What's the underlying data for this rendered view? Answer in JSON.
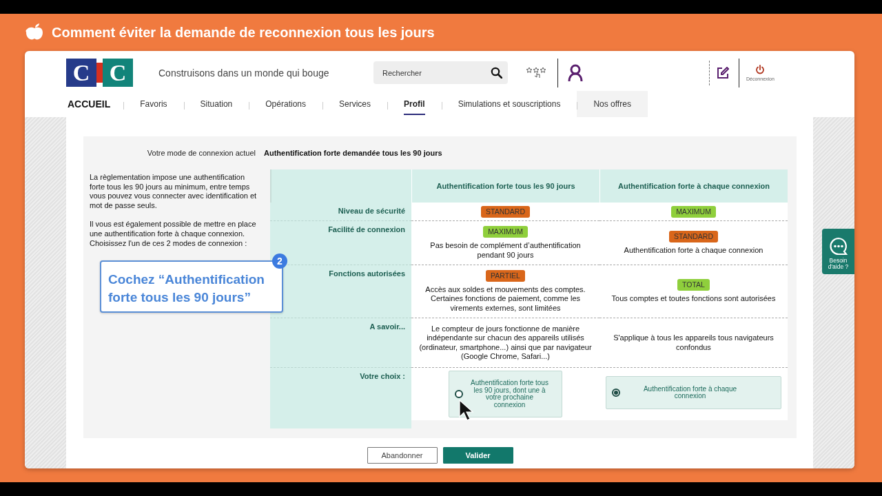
{
  "video_title": "Comment éviter la demande de reconnexion tous les jours",
  "header": {
    "logo_letters": [
      "C",
      "C"
    ],
    "tagline": "Construisons dans un monde qui bouge",
    "search": {
      "placeholder": "Rechercher"
    },
    "logout": "Déconnexion"
  },
  "nav": [
    {
      "label": "ACCUEIL",
      "kind": "home",
      "selected": false
    },
    {
      "label": "Favoris",
      "kind": "link",
      "selected": false
    },
    {
      "label": "Situation",
      "kind": "link",
      "selected": false
    },
    {
      "label": "Opérations",
      "kind": "link",
      "selected": false
    },
    {
      "label": "Services",
      "kind": "link",
      "selected": false
    },
    {
      "label": "Profil",
      "kind": "link",
      "selected": true
    },
    {
      "label": "Simulations et souscriptions",
      "kind": "link",
      "selected": false
    },
    {
      "label": "Nos offres",
      "kind": "offer",
      "selected": false
    }
  ],
  "current_mode": {
    "label": "Votre mode de connexion actuel",
    "value": "Authentification forte demandée tous les 90 jours"
  },
  "intro": [
    "La règlementation impose une authentification forte tous les 90 jours au minimum, entre temps vous pouvez vous connecter avec identification et mot de passe seuls.",
    "Il vous est également possible de mettre en place une authentification forte à chaque connexion. Choisissez l'un de ces 2 modes de connexion :"
  ],
  "callout": {
    "number": "2",
    "text": "Cochez “Authentification forte tous les 90 jours”"
  },
  "comparison": {
    "columns": [
      "Authentification forte tous les 90 jours",
      "Authentification forte à chaque connexion"
    ],
    "rows": [
      {
        "label": "Niveau de sécurité",
        "cells": [
          {
            "badge": {
              "text": "STANDARD",
              "color": "#d9661a"
            }
          },
          {
            "badge": {
              "text": "MAXIMUM",
              "color": "#8fcf3c"
            }
          }
        ]
      },
      {
        "label": "Facilité de connexion",
        "cells": [
          {
            "badge": {
              "text": "MAXIMUM",
              "color": "#8fcf3c"
            },
            "text": "Pas besoin de complément d’authentification pendant 90 jours"
          },
          {
            "badge": {
              "text": "STANDARD",
              "color": "#d9661a"
            },
            "text": "Authentification forte à chaque connexion"
          }
        ]
      },
      {
        "label": "Fonctions autorisées",
        "cells": [
          {
            "badge": {
              "text": "PARTIEL",
              "color": "#d9661a"
            },
            "text": "Accès aux soldes et mouvements des comptes. Certaines fonctions de paiement, comme les virements externes, sont limitées"
          },
          {
            "badge": {
              "text": "TOTAL",
              "color": "#8fcf3c"
            },
            "text": "Tous comptes et toutes fonctions sont autorisées"
          }
        ]
      },
      {
        "label": "A savoir...",
        "cells": [
          {
            "text": "Le compteur de jours fonctionne de manière indépendante sur chacun des appareils utilisés (ordinateur, smartphone...) ainsi que par navigateur (Google Chrome, Safari...)"
          },
          {
            "text": "S'applique à tous les appareils tous navigateurs confondus"
          }
        ]
      }
    ],
    "choice_label": "Votre choix :",
    "options": [
      {
        "text": "Authentification forte tous les 90 jours, dont une à votre prochaine connexion",
        "selected": false
      },
      {
        "text": "Authentification forte à chaque connexion",
        "selected": true
      }
    ]
  },
  "buttons": [
    {
      "label": "Abandonner",
      "kind": "secondary"
    },
    {
      "label": "Valider",
      "kind": "primary"
    }
  ],
  "help": {
    "label": "Besoin d'aide ?"
  }
}
